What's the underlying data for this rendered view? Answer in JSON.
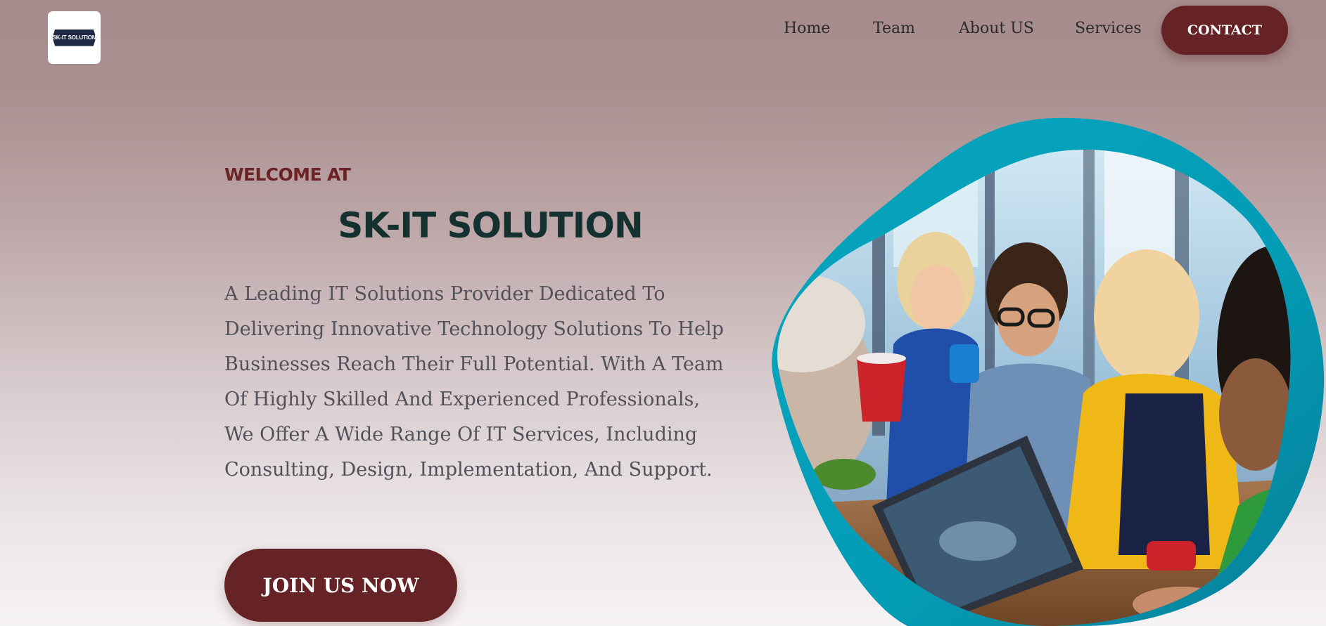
{
  "header": {
    "logo_text": "SK-IT SOLUTION",
    "nav": {
      "home": "Home",
      "team": "Team",
      "about": "About US",
      "services": "Services"
    },
    "contact_label": "CONTACT"
  },
  "hero": {
    "eyebrow": "WELCOME AT",
    "title": "SK-IT SOLUTION",
    "description": "A Leading IT Solutions Provider Dedicated To\nDelivering Innovative Technology Solutions To Help\nBusinesses Reach Their Full Potential. With A Team\nOf Highly Skilled And Experienced Professionals,\nWe Offer A Wide Range Of IT Services, Including\nConsulting, Design, Implementation, And Support.",
    "cta_label": "JOIN US NOW"
  },
  "colors": {
    "brand_maroon": "#652326",
    "heading_dark": "#14302f",
    "accent_teal": "#08a3bc"
  },
  "icons": {
    "logo": "sk-it-solution-logo",
    "hero_image": "team-meeting-photo"
  }
}
